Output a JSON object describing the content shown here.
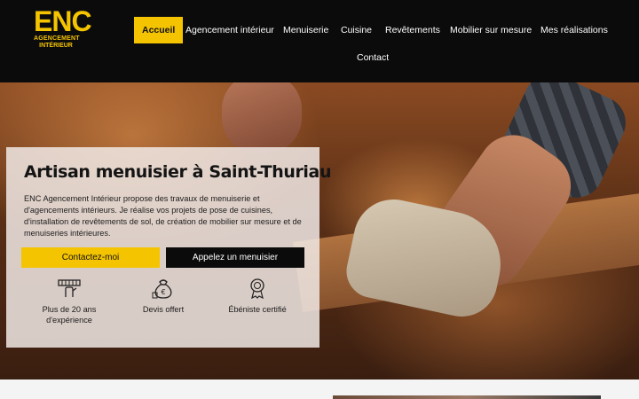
{
  "logo": {
    "mark": "ENC",
    "line1": "AGENCEMENT",
    "line2": "INTÉRIEUR"
  },
  "nav": {
    "items": [
      {
        "label": "Accueil",
        "active": true
      },
      {
        "label": "Agencement intérieur"
      },
      {
        "label": "Menuiserie"
      },
      {
        "label": "Cuisine"
      },
      {
        "label": "Revêtements"
      },
      {
        "label": "Mobilier sur mesure"
      },
      {
        "label": "Mes réalisations"
      },
      {
        "label": "Contact"
      }
    ]
  },
  "hero": {
    "title": "Artisan menuisier à Saint-Thuriau",
    "text": "ENC Agencement Intérieur propose des travaux de menuiserie et d'agencements intérieurs. Je réalise vos projets de pose de cuisines, d'installation de revêtements de sol, de création de mobilier sur mesure et de menuiseries intérieures.",
    "cta_primary": "Contactez-moi",
    "cta_secondary": "Appelez un menuisier",
    "features": [
      {
        "icon": "carpenter-hands-icon",
        "label": "Plus de 20 ans d'expérience"
      },
      {
        "icon": "money-bag-icon",
        "label": "Devis offert"
      },
      {
        "icon": "award-badge-icon",
        "label": "Ébéniste certifié"
      }
    ]
  },
  "colors": {
    "accent": "#f5c400",
    "header_bg": "#0b0b0b"
  }
}
